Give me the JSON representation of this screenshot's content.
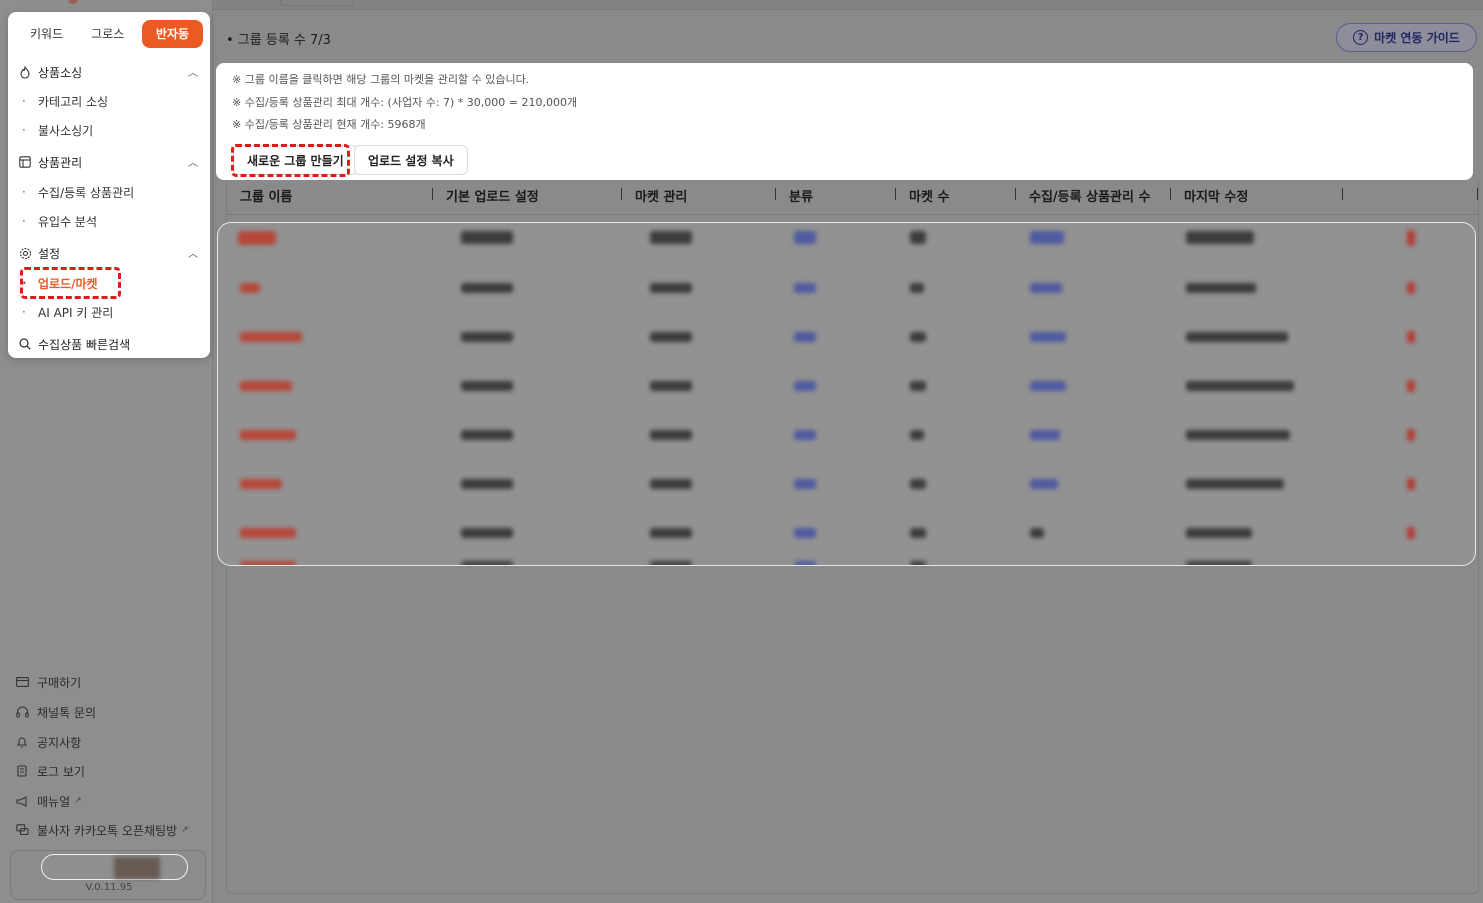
{
  "sidebar": {
    "segment_tabs": [
      {
        "label": "키워드"
      },
      {
        "label": "그로스"
      },
      {
        "label": "반자동"
      }
    ],
    "sections": [
      {
        "label": "상품소싱",
        "icon": "fire-icon",
        "items": [
          "카테고리 소싱",
          "불사소싱기"
        ]
      },
      {
        "label": "상품관리",
        "icon": "layout-icon",
        "items": [
          "수집/등록 상품관리",
          "유입수 분석"
        ]
      },
      {
        "label": "설정",
        "icon": "gear-icon",
        "items": [
          "업로드/마켓",
          "AI API 키 관리"
        ]
      }
    ],
    "quick_search": "수집상품 빠른검색",
    "bottom_items": [
      "구매하기",
      "채널톡 문의",
      "공지사항",
      "로그 보기",
      "매뉴얼",
      "불사자 카카오톡 오픈채팅방"
    ],
    "version": "V.0.11.95"
  },
  "main": {
    "group_count": "• 그룹 등록 수 7/3",
    "guide_button": "마켓 연동 가이드",
    "notes": [
      "※ 그룹 이름을 클릭하면 해당 그룹의 마켓을 관리할 수 있습니다.",
      "※ 수집/등록 상품관리 최대 개수: (사업자 수: 7) * 30,000 = 210,000개",
      "※ 수집/등록 상품관리 현재 개수: 5968개"
    ],
    "new_group_button": "새로운 그룹 만들기",
    "copy_settings_button": "업로드 설정 복사",
    "table_headers": [
      "그룹 이름",
      "기본 업로드 설정",
      "마켓 관리",
      "분류",
      "마켓 수",
      "수집/등록 상품관리 수",
      "마지막 수정"
    ]
  },
  "colors": {
    "accent": "#ea5b23",
    "highlight": "#e01b1b"
  }
}
